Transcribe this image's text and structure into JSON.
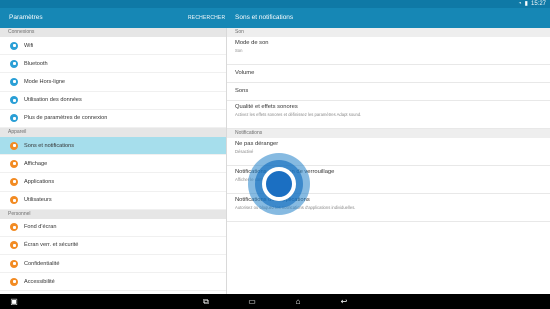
{
  "status": {
    "time": "15:27"
  },
  "header": {
    "left_title": "Paramètres",
    "search_label": "RECHERCHER",
    "right_title": "Sons et notifications"
  },
  "sidebar": {
    "sections": [
      {
        "title": "Connexions",
        "items": [
          {
            "label": "Wifi",
            "icon": "wifi-icon"
          },
          {
            "label": "Bluetooth",
            "icon": "bluetooth-icon"
          },
          {
            "label": "Mode Hors-ligne",
            "icon": "airplane-icon"
          },
          {
            "label": "Utilisation des données",
            "icon": "data-usage-icon"
          },
          {
            "label": "Plus de paramètres de connexion",
            "icon": "more-connections-icon"
          }
        ]
      },
      {
        "title": "Appareil",
        "items": [
          {
            "label": "Sons et notifications",
            "icon": "sound-icon",
            "active": true
          },
          {
            "label": "Affichage",
            "icon": "display-icon"
          },
          {
            "label": "Applications",
            "icon": "apps-icon"
          },
          {
            "label": "Utilisateurs",
            "icon": "users-icon"
          }
        ]
      },
      {
        "title": "Personnel",
        "items": [
          {
            "label": "Fond d'écran",
            "icon": "wallpaper-icon"
          },
          {
            "label": "Écran verr. et sécurité",
            "icon": "lock-icon"
          },
          {
            "label": "Confidentialité",
            "icon": "privacy-icon"
          },
          {
            "label": "Accessibilité",
            "icon": "accessibility-icon"
          }
        ]
      }
    ]
  },
  "content": {
    "sections": [
      {
        "title": "Son",
        "items": [
          {
            "title": "Mode de son",
            "subtitle": "Son"
          },
          {
            "title": "Volume",
            "subtitle": ""
          },
          {
            "title": "Sons",
            "subtitle": ""
          },
          {
            "title": "Qualité et effets sonores",
            "subtitle": "Activez les effets sonores et définissez les paramètres Adapt sound."
          }
        ]
      },
      {
        "title": "Notifications",
        "items": [
          {
            "title": "Ne pas déranger",
            "subtitle": "Désactivé"
          },
          {
            "title": "Notifications sur l'écran de verrouillage",
            "subtitle": "Afficher le contenu"
          },
          {
            "title": "Notifications des applications",
            "subtitle": "Autorisez ou bloquez les notifications d'applications individuelles."
          }
        ]
      }
    ]
  },
  "navbar": {
    "buttons": [
      "recent-apps-icon",
      "multi-window-icon",
      "home-icon",
      "back-icon"
    ]
  },
  "colors": {
    "accent": "#1687b5",
    "active_row": "#a6deec",
    "icon_blue": "#2a9fd6",
    "icon_orange": "#f28b23"
  }
}
